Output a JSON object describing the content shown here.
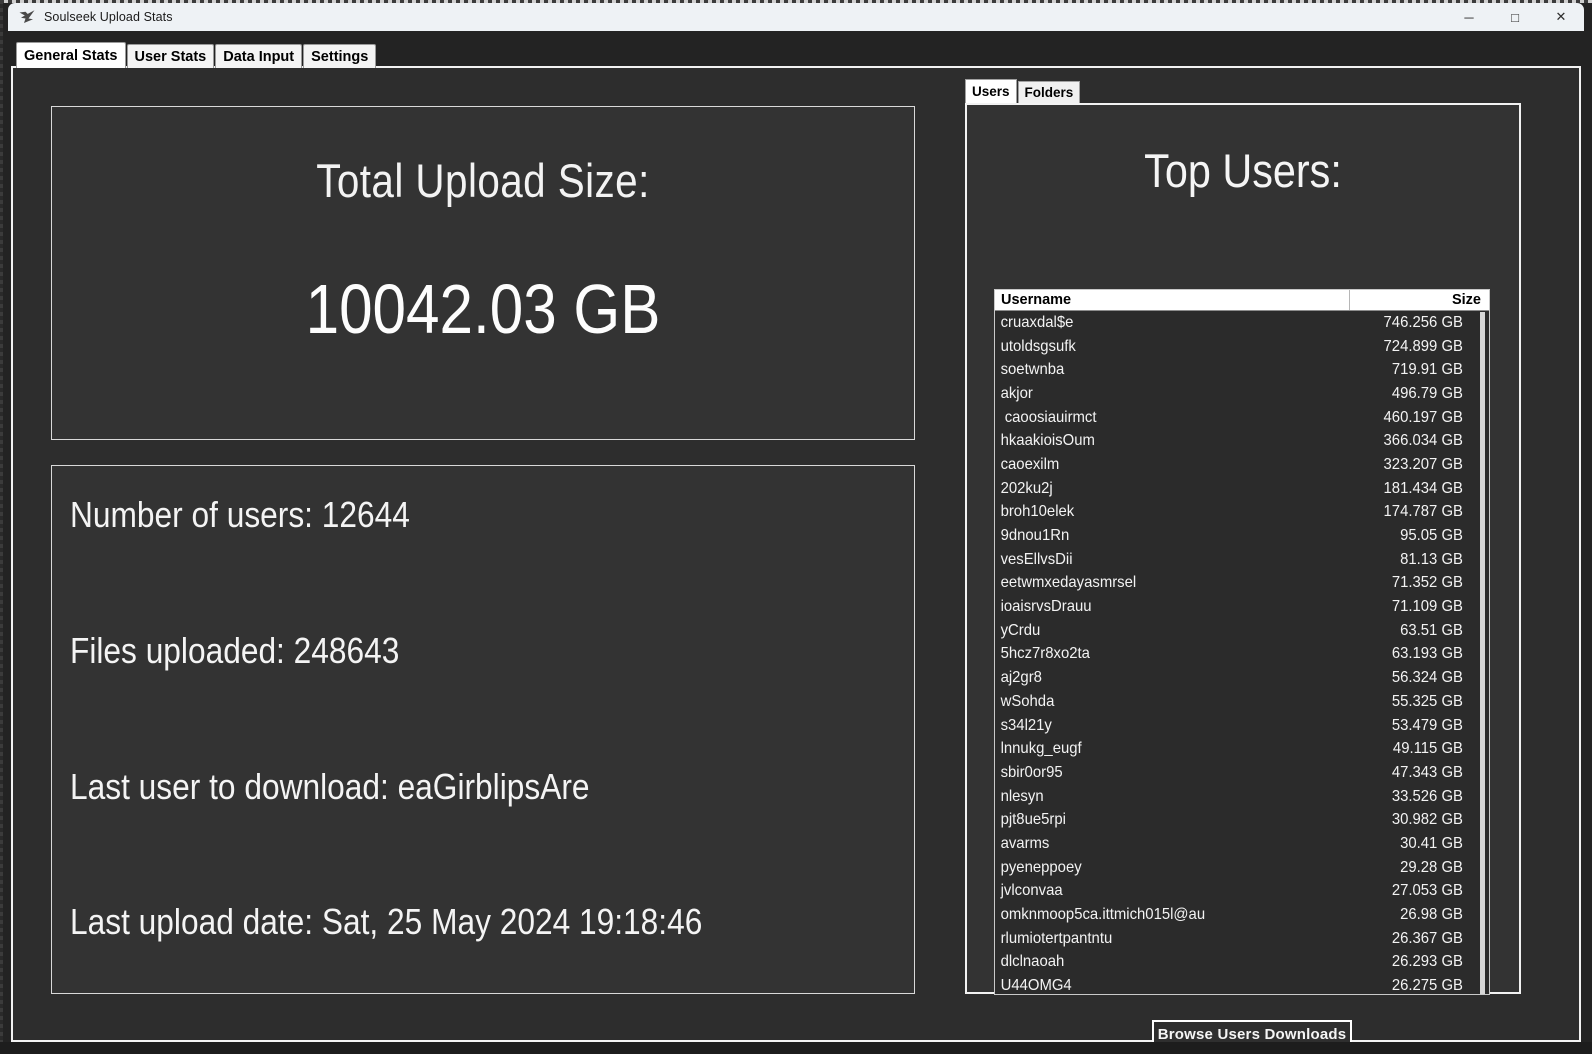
{
  "window": {
    "title": "Soulseek Upload Stats",
    "icon": "soulseek-logo-icon",
    "minimize_glyph": "─",
    "maximize_glyph": "□",
    "close_glyph": "✕"
  },
  "main_tabs": [
    {
      "label": "General Stats",
      "active": true
    },
    {
      "label": "User Stats",
      "active": false
    },
    {
      "label": "Data Input",
      "active": false
    },
    {
      "label": "Settings",
      "active": false
    }
  ],
  "total_panel": {
    "title": "Total Upload Size:",
    "value": "10042.03 GB"
  },
  "stats_panel": {
    "lines": [
      "Number of users: 12644",
      "Files uploaded: 248643",
      "Last user to download: eaGirblipsAre",
      "Last upload date: Sat, 25 May 2024 19:18:46"
    ]
  },
  "right_tabs": [
    {
      "label": "Users",
      "active": true
    },
    {
      "label": "Folders",
      "active": false
    }
  ],
  "users_panel": {
    "title": "Top Users:",
    "columns": [
      "Username",
      "Size"
    ],
    "rows": [
      [
        "cruaxdal$e",
        "746.256 GB"
      ],
      [
        "utoldsgsufk",
        "724.899 GB"
      ],
      [
        "soetwnba",
        "719.91 GB"
      ],
      [
        "akjor",
        "496.79 GB"
      ],
      [
        " caoosiauirmct",
        "460.197 GB"
      ],
      [
        "hkaakioisOum",
        "366.034 GB"
      ],
      [
        "caoexilm",
        "323.207 GB"
      ],
      [
        "202ku2j",
        "181.434 GB"
      ],
      [
        "broh10elek",
        "174.787 GB"
      ],
      [
        "9dnou1Rn",
        "95.05 GB"
      ],
      [
        "vesEllvsDii",
        "81.13 GB"
      ],
      [
        "eetwmxedayasmrsel",
        "71.352 GB"
      ],
      [
        "ioaisrvsDrauu",
        "71.109 GB"
      ],
      [
        "yCrdu",
        "63.51 GB"
      ],
      [
        "5hcz7r8xo2ta",
        "63.193 GB"
      ],
      [
        "aj2gr8",
        "56.324 GB"
      ],
      [
        "wSohda",
        "55.325 GB"
      ],
      [
        "s34l21y",
        "53.479 GB"
      ],
      [
        "lnnukg_eugf",
        "49.115 GB"
      ],
      [
        "sbir0or95",
        "47.343 GB"
      ],
      [
        "nlesyn",
        "33.526 GB"
      ],
      [
        "pjt8ue5rpi",
        "30.982 GB"
      ],
      [
        "avarms",
        "30.41 GB"
      ],
      [
        "pyeneppoey",
        "29.28 GB"
      ],
      [
        "jvlconvaa",
        "27.053 GB"
      ],
      [
        "omknmoop5ca.ittmich015l@au",
        "26.98 GB"
      ],
      [
        "rlumiotertpantntu",
        "26.367 GB"
      ],
      [
        "dlclnaoah",
        "26.293 GB"
      ],
      [
        "U44OMG4",
        "26.275 GB"
      ]
    ],
    "browse_button": "Browse Users Downloads"
  },
  "colors": {
    "window_chrome": "#eef2f5",
    "client_background": "#2d2d2d",
    "panel_background": "#333333",
    "panel_border": "#d9d9d9",
    "text_primary": "#f4f4f4",
    "tab_active": "#ffffff",
    "tab_inactive": "#f0f0f0"
  }
}
